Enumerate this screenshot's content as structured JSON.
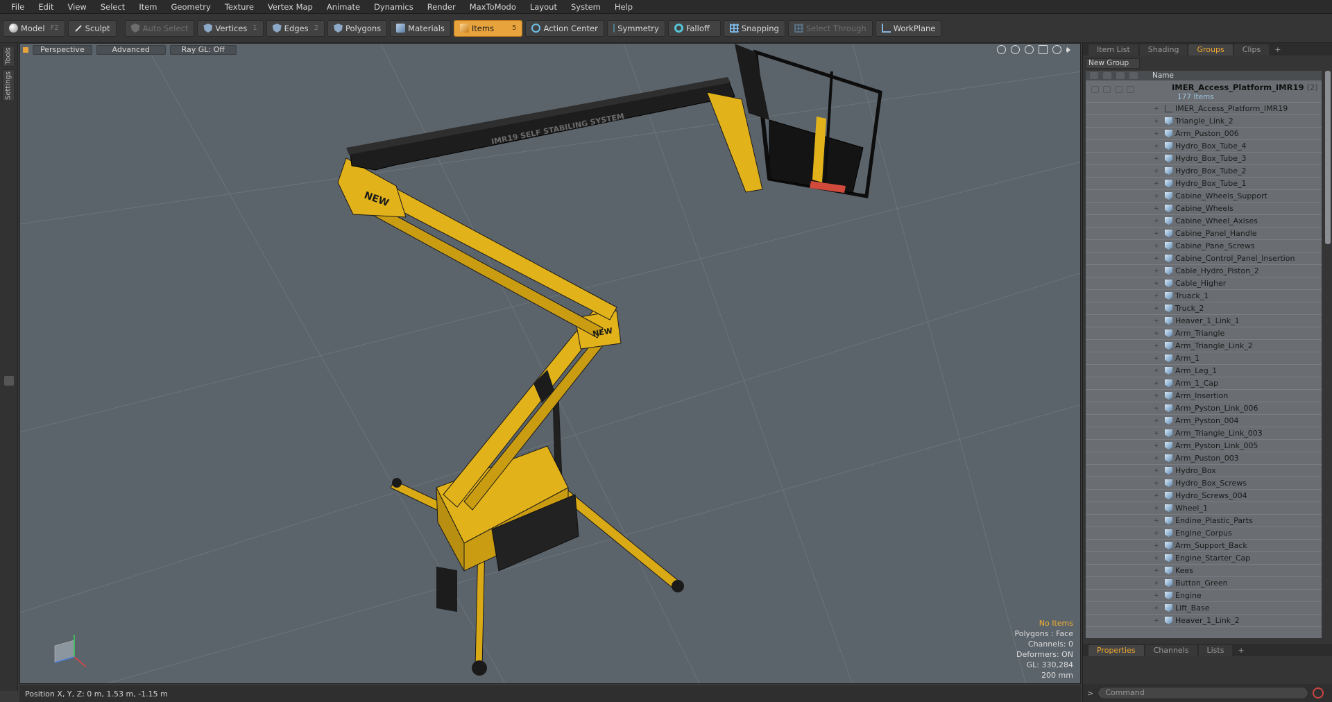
{
  "menu": [
    "File",
    "Edit",
    "View",
    "Select",
    "Item",
    "Geometry",
    "Texture",
    "Vertex Map",
    "Animate",
    "Dynamics",
    "Render",
    "MaxToModo",
    "Layout",
    "System",
    "Help"
  ],
  "toolbar": {
    "model": {
      "label": "Model",
      "key": "F2"
    },
    "sculpt": {
      "label": "Sculpt"
    },
    "auto_select": {
      "label": "Auto Select"
    },
    "vertices": {
      "label": "Vertices",
      "key": "1"
    },
    "edges": {
      "label": "Edges",
      "key": "2"
    },
    "polygons": {
      "label": "Polygons"
    },
    "materials": {
      "label": "Materials"
    },
    "items": {
      "label": "Items",
      "key": "5"
    },
    "action_center": {
      "label": "Action Center"
    },
    "symmetry": {
      "label": "Symmetry"
    },
    "falloff": {
      "label": "Falloff"
    },
    "snapping": {
      "label": "Snapping"
    },
    "select_through": {
      "label": "Select Through"
    },
    "workplane": {
      "label": "WorkPlane"
    }
  },
  "left_tabs": {
    "tools": "Tools",
    "settings": "Settings"
  },
  "viewport": {
    "perspective": "Perspective",
    "advanced": "Advanced",
    "raygl": "Ray GL: Off",
    "info": {
      "selection": "No Items",
      "polygons": "Polygons : Face",
      "channels": "Channels: 0",
      "deformers": "Deformers: ON",
      "gl": "GL: 330,284",
      "scale": "200 mm"
    },
    "decal_new": "NEW",
    "boom_text": "IMR19  SELF STABILING SYSTEM"
  },
  "status": {
    "position": "Position X, Y, Z:  0 m, 1.53 m, -1.15 m"
  },
  "right_panel": {
    "tabs": [
      "Item List",
      "Shading",
      "Groups",
      "Clips"
    ],
    "active_tab": "Groups",
    "new_group": "New Group",
    "name_header": "Name",
    "root": {
      "name": "IMER_Access_Platform_IMR19",
      "count": "(2)",
      "sub": "177 Items"
    },
    "items": [
      "IMER_Access_Platform_IMR19",
      "Triangle_Link_2",
      "Arm_Puston_006",
      "Hydro_Box_Tube_4",
      "Hydro_Box_Tube_3",
      "Hydro_Box_Tube_2",
      "Hydro_Box_Tube_1",
      "Cabine_Wheels_Support",
      "Cabine_Wheels",
      "Cabine_Wheel_Axises",
      "Cabine_Panel_Handle",
      "Cabine_Pane_Screws",
      "Cabine_Control_Panel_Insertion",
      "Cable_Hydro_Piston_2",
      "Cable_Higher",
      "Truack_1",
      "Truck_2",
      "Heaver_1_Link_1",
      "Arm_Triangle",
      "Arm_Triangle_Link_2",
      "Arm_1",
      "Arm_Leg_1",
      "Arm_1_Cap",
      "Arm_Insertion",
      "Arm_Pyston_Link_006",
      "Arm_Pyston_004",
      "Arm_Triangle_Link_003",
      "Arm_Pyston_Link_005",
      "Arm_Puston_003",
      "Hydro_Box",
      "Hydro_Box_Screws",
      "Hydro_Screws_004",
      "Wheel_1",
      "Endine_Plastic_Parts",
      "Engine_Corpus",
      "Arm_Support_Back",
      "Engine_Starter_Cap",
      "Kees",
      "Button_Green",
      "Engine",
      "Lift_Base",
      "Heaver_1_Link_2"
    ],
    "bottom_tabs": [
      "Properties",
      "Channels",
      "Lists"
    ],
    "active_bottom": "Properties",
    "command_placeholder": "Command"
  },
  "colors": {
    "accent": "#e8a33d",
    "viewport_bg": "#5c646b",
    "machine_yellow": "#e2b21a"
  }
}
